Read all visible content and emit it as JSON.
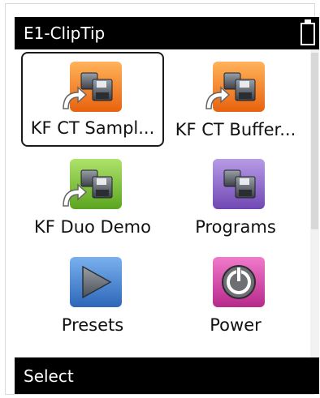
{
  "header": {
    "title": "E1-ClipTip"
  },
  "status": {
    "battery_icon": "battery-icon"
  },
  "items": [
    {
      "label": "KF CT Sampl...",
      "icon": "orange-floppy-shortcut-icon",
      "color": "#f07a1e",
      "selected": true
    },
    {
      "label": "KF CT Buffer...",
      "icon": "orange-floppy-shortcut-icon",
      "color": "#f07a1e",
      "selected": false
    },
    {
      "label": "KF Duo Demo",
      "icon": "green-floppy-shortcut-icon",
      "color": "#7cc435",
      "selected": false
    },
    {
      "label": "Programs",
      "icon": "purple-floppy-icon",
      "color": "#8e63c7",
      "selected": false
    },
    {
      "label": "Presets",
      "icon": "blue-play-icon",
      "color": "#3b7fd0",
      "selected": false
    },
    {
      "label": "Power",
      "icon": "magenta-power-icon",
      "color": "#d43fa8",
      "selected": false
    }
  ],
  "footer": {
    "softkey_label": "Select"
  }
}
